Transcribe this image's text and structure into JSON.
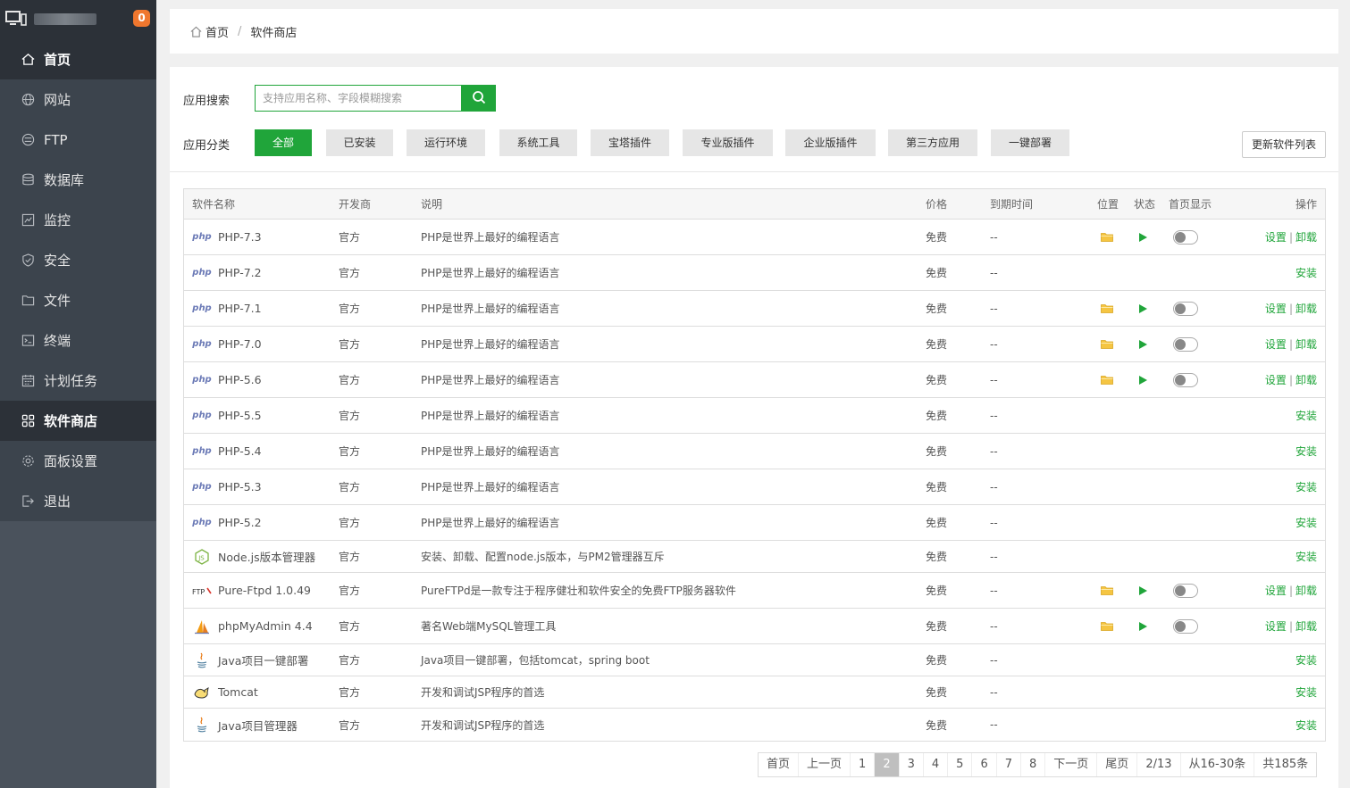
{
  "sidebar": {
    "badge": "0",
    "items": [
      {
        "label": "首页",
        "icon": "home-icon"
      },
      {
        "label": "网站",
        "icon": "globe-icon"
      },
      {
        "label": "FTP",
        "icon": "ftp-icon"
      },
      {
        "label": "数据库",
        "icon": "database-icon"
      },
      {
        "label": "监控",
        "icon": "monitor-chart-icon"
      },
      {
        "label": "安全",
        "icon": "shield-icon"
      },
      {
        "label": "文件",
        "icon": "folder-icon"
      },
      {
        "label": "终端",
        "icon": "terminal-icon"
      },
      {
        "label": "计划任务",
        "icon": "calendar-icon"
      },
      {
        "label": "软件商店",
        "icon": "grid-icon"
      },
      {
        "label": "面板设置",
        "icon": "gear-icon"
      },
      {
        "label": "退出",
        "icon": "logout-icon"
      }
    ]
  },
  "breadcrumb": {
    "home": "首页",
    "sep": "/",
    "current": "软件商店"
  },
  "search": {
    "label": "应用搜索",
    "placeholder": "支持应用名称、字段模糊搜索"
  },
  "category": {
    "label": "应用分类",
    "items": [
      "全部",
      "已安装",
      "运行环境",
      "系统工具",
      "宝塔插件",
      "专业版插件",
      "企业版插件",
      "第三方应用",
      "一键部署"
    ],
    "selected": "全部"
  },
  "update_button": "更新软件列表",
  "table": {
    "headers": {
      "name": "软件名称",
      "dev": "开发商",
      "desc": "说明",
      "price": "价格",
      "expire": "到期时间",
      "location": "位置",
      "status": "状态",
      "home": "首页显示",
      "op": "操作"
    },
    "op_labels": {
      "settings": "设置",
      "uninstall": "卸载",
      "install": "安装",
      "sep": "|"
    },
    "rows": [
      {
        "name": "PHP-7.3",
        "dev": "官方",
        "desc": "PHP是世界上最好的编程语言",
        "price": "免费",
        "expire": "--",
        "installed": true,
        "logo": "php-logo"
      },
      {
        "name": "PHP-7.2",
        "dev": "官方",
        "desc": "PHP是世界上最好的编程语言",
        "price": "免费",
        "expire": "--",
        "installed": false,
        "logo": "php-logo"
      },
      {
        "name": "PHP-7.1",
        "dev": "官方",
        "desc": "PHP是世界上最好的编程语言",
        "price": "免费",
        "expire": "--",
        "installed": true,
        "logo": "php-logo"
      },
      {
        "name": "PHP-7.0",
        "dev": "官方",
        "desc": "PHP是世界上最好的编程语言",
        "price": "免费",
        "expire": "--",
        "installed": true,
        "logo": "php-logo"
      },
      {
        "name": "PHP-5.6",
        "dev": "官方",
        "desc": "PHP是世界上最好的编程语言",
        "price": "免费",
        "expire": "--",
        "installed": true,
        "logo": "php-logo"
      },
      {
        "name": "PHP-5.5",
        "dev": "官方",
        "desc": "PHP是世界上最好的编程语言",
        "price": "免费",
        "expire": "--",
        "installed": false,
        "logo": "php-logo"
      },
      {
        "name": "PHP-5.4",
        "dev": "官方",
        "desc": "PHP是世界上最好的编程语言",
        "price": "免费",
        "expire": "--",
        "installed": false,
        "logo": "php-logo"
      },
      {
        "name": "PHP-5.3",
        "dev": "官方",
        "desc": "PHP是世界上最好的编程语言",
        "price": "免费",
        "expire": "--",
        "installed": false,
        "logo": "php-logo"
      },
      {
        "name": "PHP-5.2",
        "dev": "官方",
        "desc": "PHP是世界上最好的编程语言",
        "price": "免费",
        "expire": "--",
        "installed": false,
        "logo": "php-logo"
      },
      {
        "name": "Node.js版本管理器",
        "dev": "官方",
        "desc": "安装、卸载、配置node.js版本，与PM2管理器互斥",
        "price": "免费",
        "expire": "--",
        "installed": false,
        "logo": "nodejs-logo"
      },
      {
        "name": "Pure-Ftpd 1.0.49",
        "dev": "官方",
        "desc": "PureFTPd是一款专注于程序健壮和软件安全的免费FTP服务器软件",
        "price": "免费",
        "expire": "--",
        "installed": true,
        "logo": "ftp-logo"
      },
      {
        "name": "phpMyAdmin 4.4",
        "dev": "官方",
        "desc": "著名Web端MySQL管理工具",
        "price": "免费",
        "expire": "--",
        "installed": true,
        "logo": "phpmyadmin-logo"
      },
      {
        "name": "Java项目一键部署",
        "dev": "官方",
        "desc": "Java项目一键部署，包括tomcat，spring boot",
        "price": "免费",
        "expire": "--",
        "installed": false,
        "logo": "java-logo"
      },
      {
        "name": "Tomcat",
        "dev": "官方",
        "desc": "开发和调试JSP程序的首选",
        "price": "免费",
        "expire": "--",
        "installed": false,
        "logo": "tomcat-logo"
      },
      {
        "name": "Java项目管理器",
        "dev": "官方",
        "desc": "开发和调试JSP程序的首选",
        "price": "免费",
        "expire": "--",
        "installed": false,
        "logo": "java-logo"
      }
    ]
  },
  "pagination": {
    "first": "首页",
    "prev": "上一页",
    "pages": [
      "1",
      "2",
      "3",
      "4",
      "5",
      "6",
      "7",
      "8"
    ],
    "current": "2",
    "next": "下一页",
    "last": "尾页",
    "page_info": "2/13",
    "range_info": "从16-30条",
    "total_info": "共185条"
  },
  "colors": {
    "accent": "#20a53a",
    "sidebar": "#3c444d",
    "sidebar_dark": "#2c3138",
    "badge": "#f0772e"
  }
}
